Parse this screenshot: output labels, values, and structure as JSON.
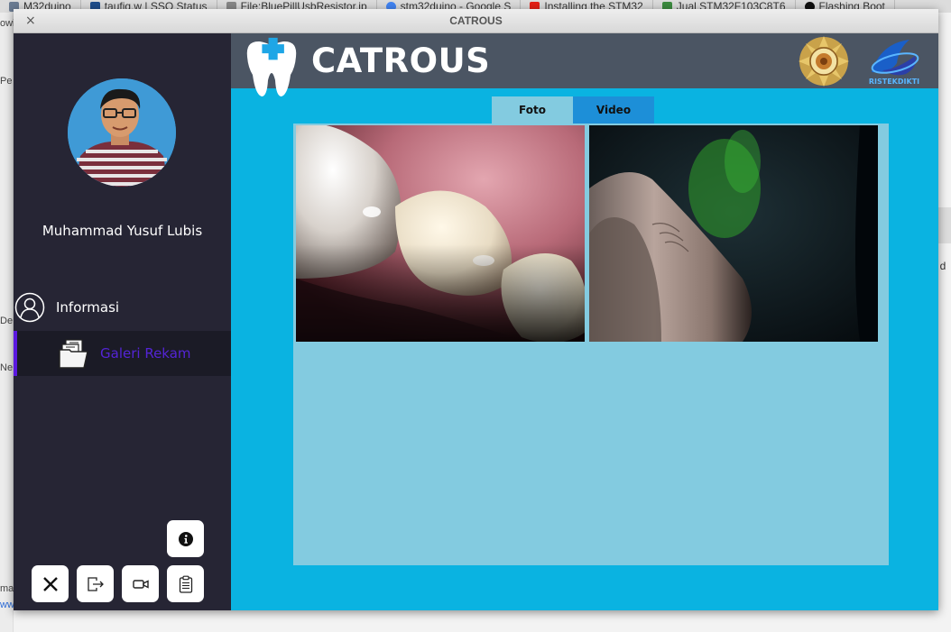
{
  "background_browser": {
    "tabs": [
      {
        "label": "M32duino",
        "color": "#6b7c93"
      },
      {
        "label": "taufiq.w | SSO Status",
        "color": "#1f4e8c"
      },
      {
        "label": "File:BluePillUsbResistor.jp",
        "color": "#888888"
      },
      {
        "label": "stm32duino - Google S",
        "color": "#4285f4"
      },
      {
        "label": "Installing the STM32",
        "color": "#e62117"
      },
      {
        "label": "Jual STM32F103C8T6",
        "color": "#3d8c40"
      },
      {
        "label": "Flashing Boot",
        "color": "#111111"
      }
    ],
    "right_fragment": "t d",
    "left_fragments": [
      "owi",
      "Pe",
      "De",
      "Ne",
      "ma",
      "ww"
    ]
  },
  "window": {
    "title": "CATROUS",
    "close_glyph": "×"
  },
  "sidebar": {
    "user_name": "Muhammad Yusuf Lubis",
    "nav": [
      {
        "label": "Informasi",
        "icon": "user-icon",
        "active": false
      },
      {
        "label": "Galeri Rekam",
        "icon": "documents-icon",
        "active": true
      }
    ],
    "buttons": {
      "info": "info-icon",
      "close": "close-icon",
      "logout": "logout-icon",
      "video": "video-camera-icon",
      "clipboard": "clipboard-icon"
    },
    "accent_color": "#5b19e0"
  },
  "header": {
    "app_title": "CATROUS",
    "logos": [
      "tooth-logo",
      "ugm-logo",
      "ristekdikti-logo"
    ],
    "ristek_text": "RISTEKDIKTI"
  },
  "tabs": [
    {
      "label": "Foto",
      "active": true
    },
    {
      "label": "Video",
      "active": false
    }
  ],
  "gallery": {
    "items": [
      {
        "type": "photo",
        "subject": "intraoral teeth photo"
      },
      {
        "type": "photo",
        "subject": "finger under low light"
      }
    ]
  },
  "colors": {
    "main_bg": "#0ab3e1",
    "header_bg": "#4b5563",
    "panel_bg": "#83cbe0",
    "sidebar_bg": "#262534",
    "tab_inactive": "#1d8fd8"
  }
}
